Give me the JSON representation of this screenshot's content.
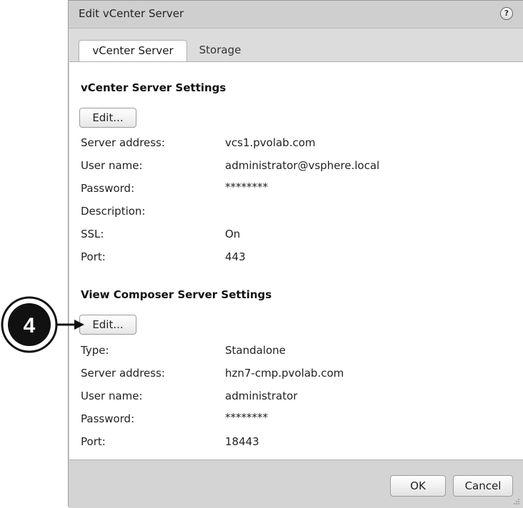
{
  "dialog": {
    "title": "Edit vCenter Server",
    "help_icon": "question-icon",
    "tabs": [
      "vCenter Server",
      "Storage"
    ]
  },
  "vcenter": {
    "heading": "vCenter Server Settings",
    "edit_label": "Edit...",
    "fields": [
      {
        "label": "Server address:",
        "value": "vcs1.pvolab.com"
      },
      {
        "label": "User name:",
        "value": "administrator@vsphere.local"
      },
      {
        "label": "Password:",
        "value": "********"
      },
      {
        "label": "Description:",
        "value": ""
      },
      {
        "label": "SSL:",
        "value": "On"
      },
      {
        "label": "Port:",
        "value": "443"
      }
    ]
  },
  "composer": {
    "heading": "View Composer Server Settings",
    "edit_label": "Edit...",
    "fields": [
      {
        "label": "Type:",
        "value": "Standalone"
      },
      {
        "label": "Server address:",
        "value": "hzn7-cmp.pvolab.com"
      },
      {
        "label": "User name:",
        "value": "administrator"
      },
      {
        "label": "Password:",
        "value": "********"
      },
      {
        "label": "Port:",
        "value": "18443"
      }
    ]
  },
  "footer": {
    "ok_label": "OK",
    "cancel_label": "Cancel"
  },
  "callout": {
    "number": "4"
  }
}
